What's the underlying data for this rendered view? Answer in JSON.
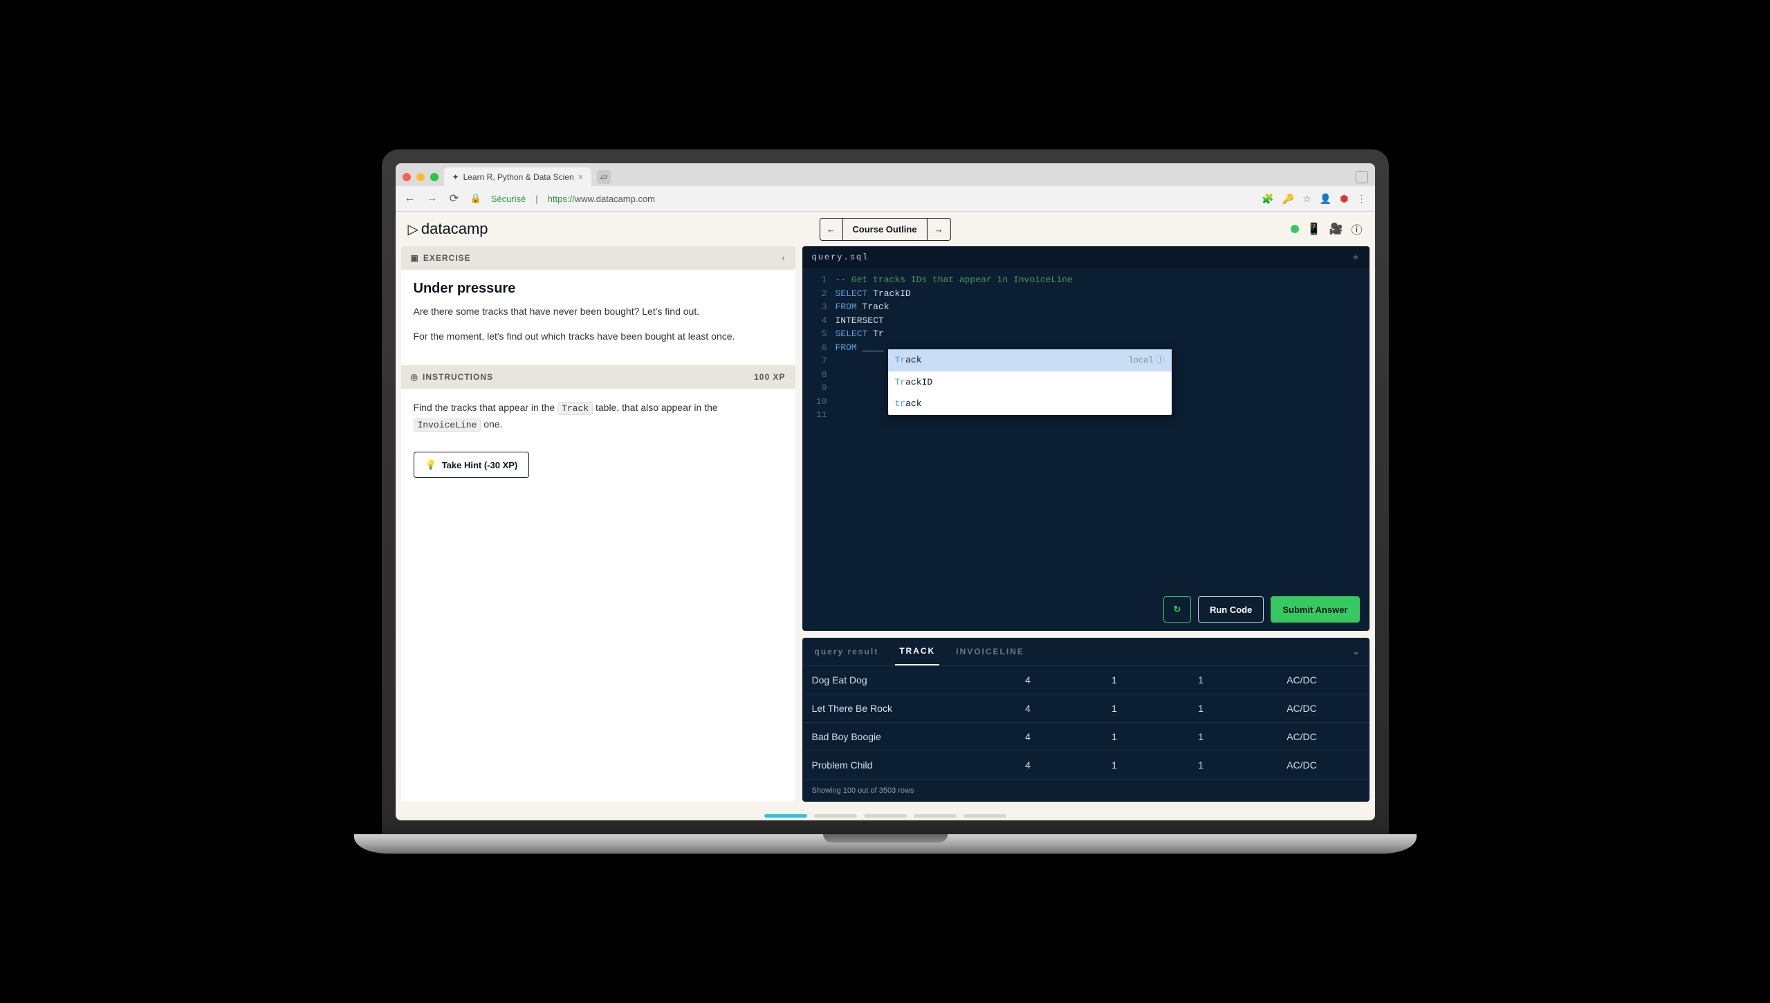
{
  "browser": {
    "tab_title": "Learn R, Python & Data Scien",
    "secure_label": "Sécurisé",
    "url_prefix": "https://",
    "url_host": "www.datacamp.com"
  },
  "header": {
    "brand": "datacamp",
    "course_outline": "Course Outline"
  },
  "exercise": {
    "section_label": "EXERCISE",
    "title": "Under pressure",
    "p1": "Are there some tracks that have never been bought? Let's find out.",
    "p2": "For the moment, let's find out which tracks have been bought at least once."
  },
  "instructions": {
    "section_label": "INSTRUCTIONS",
    "xp": "100 XP",
    "text_1": "Find the tracks that appear in the ",
    "code_1": "Track",
    "text_2": " table, that also appear in the ",
    "code_2": "InvoiceLine",
    "text_3": " one.",
    "hint": "Take Hint (-30 XP)"
  },
  "editor": {
    "filename": "query.sql",
    "lines": {
      "l1": "-- Get tracks IDs that appear in InvoiceLine",
      "l2_kw": "SELECT",
      "l2_rest": " TrackID",
      "l3_kw": "FROM",
      "l3_rest": " Track",
      "l4": "INTERSECT",
      "l5_kw": "SELECT",
      "l5_rest": " Tr",
      "l6_kw": "FROM",
      "l6_rest": " ____"
    },
    "autocomplete": {
      "o1_pre": "Tr",
      "o1_suf": "ack",
      "o1_meta": "local",
      "o2_pre": "Tr",
      "o2_suf": "ackID",
      "o3_pre": "tr",
      "o3_suf": "ack"
    },
    "run": "Run Code",
    "submit": "Submit Answer"
  },
  "results": {
    "tab_query": "query result",
    "tab_track": "TRACK",
    "tab_invoice": "INVOICELINE",
    "rows": [
      {
        "c1": "Dog Eat Dog",
        "c2": "4",
        "c3": "1",
        "c4": "1",
        "c5": "AC/DC"
      },
      {
        "c1": "Let There Be Rock",
        "c2": "4",
        "c3": "1",
        "c4": "1",
        "c5": "AC/DC"
      },
      {
        "c1": "Bad Boy Boogie",
        "c2": "4",
        "c3": "1",
        "c4": "1",
        "c5": "AC/DC"
      },
      {
        "c1": "Problem Child",
        "c2": "4",
        "c3": "1",
        "c4": "1",
        "c5": "AC/DC"
      }
    ],
    "footer": "Showing 100 out of 3503 rows"
  }
}
